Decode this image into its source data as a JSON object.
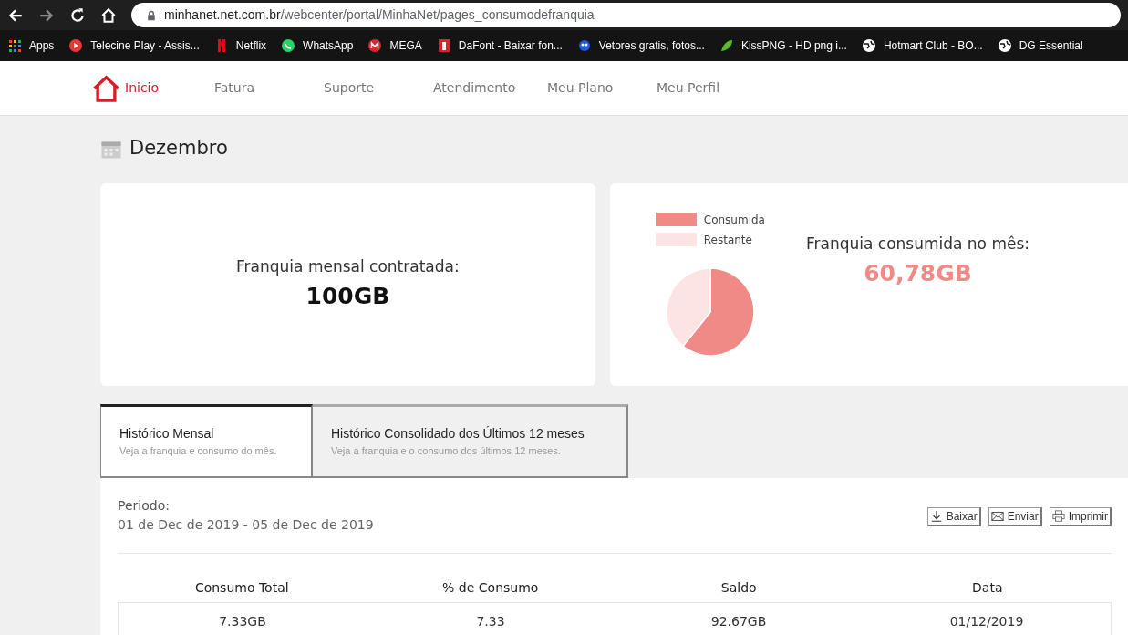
{
  "browser": {
    "url_host": "minhanet.net.com.br",
    "url_path": "/webcenter/portal/MinhaNet/pages_consumodefranquia",
    "bookmarks": [
      {
        "label": "Apps",
        "kind": "apps"
      },
      {
        "label": "Telecine Play - Assis...",
        "kind": "play"
      },
      {
        "label": "Netflix",
        "kind": "netflix"
      },
      {
        "label": "WhatsApp",
        "kind": "whatsapp"
      },
      {
        "label": "MEGA",
        "kind": "mega"
      },
      {
        "label": "DaFont - Baixar fon...",
        "kind": "dafont"
      },
      {
        "label": "Vetores gratis, fotos...",
        "kind": "vector"
      },
      {
        "label": "KissPNG - HD png i...",
        "kind": "leaf"
      },
      {
        "label": "Hotmart Club - BO...",
        "kind": "globe"
      },
      {
        "label": "DG Essential",
        "kind": "globe"
      }
    ]
  },
  "nav": [
    {
      "label": "Inicio",
      "selected": true
    },
    {
      "label": "Fatura",
      "selected": false
    },
    {
      "label": "Suporte",
      "selected": false
    },
    {
      "label": "Atendimento",
      "selected": false
    },
    {
      "label": "Meu Plano",
      "selected": false
    },
    {
      "label": "Meu Perfil",
      "selected": false
    }
  ],
  "month": "Dezembro",
  "plan_card": {
    "label": "Franquia mensal contratada:",
    "value": "100GB"
  },
  "usage_card": {
    "label": "Franquia consumida no mês:",
    "value": "60,78GB",
    "chart_data": {
      "type": "pie",
      "categories": [
        "Consumida",
        "Restante"
      ],
      "series": [
        {
          "values": [
            60.78,
            39.22
          ]
        }
      ],
      "colors": [
        "#f08a86",
        "#fce4e3"
      ],
      "legend": true
    }
  },
  "tabs": [
    {
      "title": "Histórico Mensal",
      "subtitle": "Veja a franquia e consumo do mês.",
      "selected": true
    },
    {
      "title": "Histórico Consolidado dos Últimos 12 meses",
      "subtitle": "Veja a franquia e o consumo dos últimos 12 meses.",
      "selected": false
    }
  ],
  "period": {
    "label": "Periodo:",
    "value": "01 de Dec de 2019 - 05 de Dec de 2019"
  },
  "actions": [
    {
      "label": "Baixar",
      "kind": "download"
    },
    {
      "label": "Enviar",
      "kind": "mail"
    },
    {
      "label": "Imprimir",
      "kind": "print"
    }
  ],
  "table": {
    "columns": [
      "Consumo Total",
      "% de Consumo",
      "Saldo",
      "Data"
    ],
    "rows": [
      [
        "7.33GB",
        "7.33",
        "92.67GB",
        "01/12/2019"
      ]
    ]
  }
}
